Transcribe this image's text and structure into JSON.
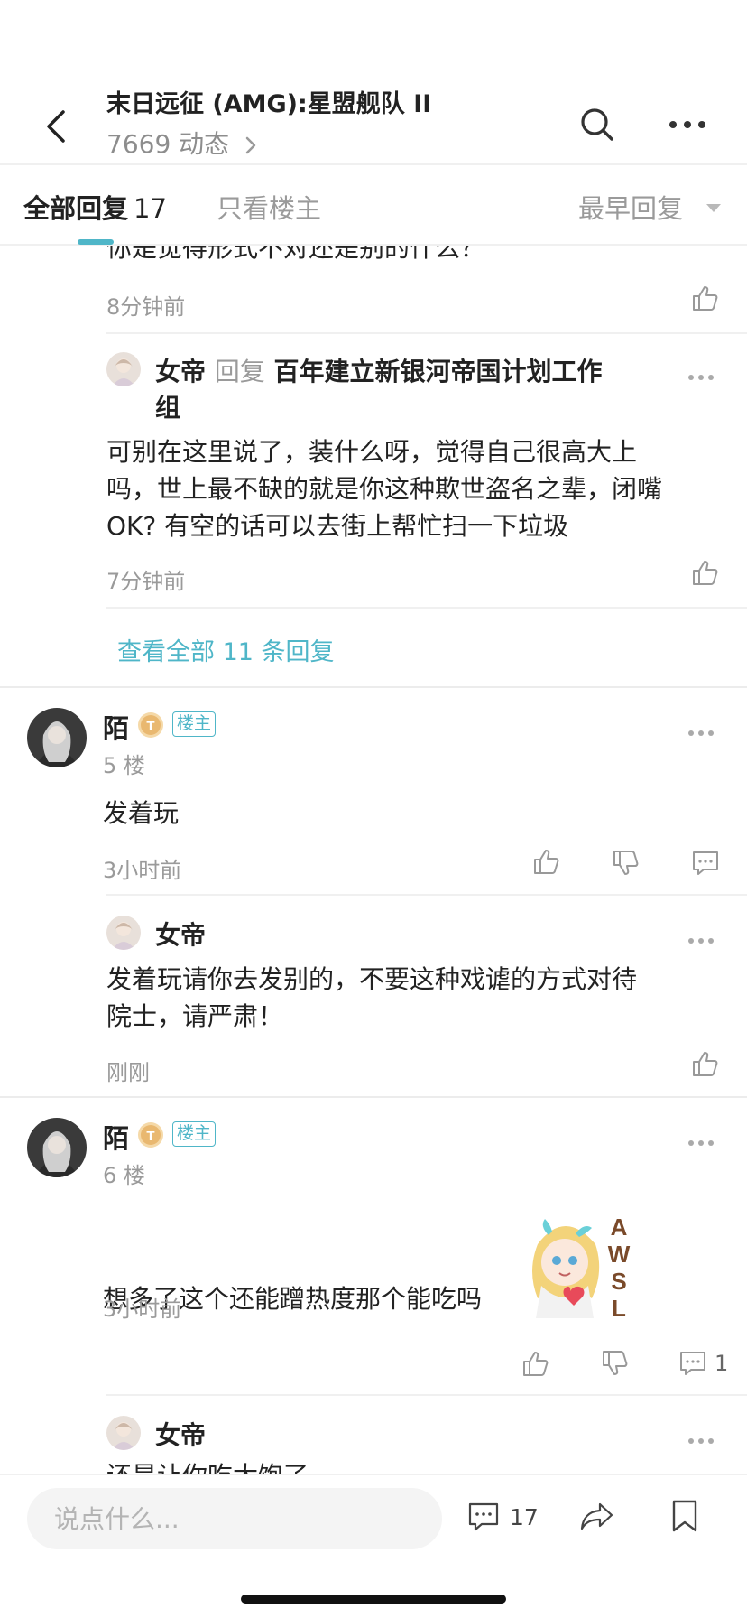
{
  "nav": {
    "title": "末日远征 (AMG):星盟舰队 II",
    "subtitle": "7669 动态"
  },
  "tabs": {
    "all_label": "全部回复",
    "all_count": "17",
    "owner_only": "只看楼主",
    "sort": "最早回复"
  },
  "thread": {
    "partial_text": "你是觉得形式不对还是别的什么？",
    "partial_time": "8分钟前",
    "reply1": {
      "author": "女帝",
      "reply_word": "回复",
      "target_line1": "百年建立新银河帝国计划工作",
      "target_line2": "组",
      "text_line1": "可别在这里说了，装什么呀，觉得自己很高大上",
      "text_line2": "吗，世上最不缺的就是你这种欺世盗名之辈，闭嘴",
      "text_line3": "OK?  有空的话可以去街上帮忙扫一下垃圾",
      "time": "7分钟前"
    },
    "view_all": "查看全部 11 条回复"
  },
  "posts": [
    {
      "author": "陌",
      "owner_badge": "楼主",
      "floor": "5 楼",
      "text": "发着玩",
      "time": "3小时前",
      "reply": {
        "author": "女帝",
        "text_line1": "发着玩请你去发别的，不要这种戏谑的方式对待",
        "text_line2": "院士，请严肃！",
        "time": "刚刚"
      }
    },
    {
      "author": "陌",
      "owner_badge": "楼主",
      "floor": "6 楼",
      "text": "想多了这个还能蹭热度那个能吃吗",
      "sticker_text": "AWSL",
      "time": "3小时前",
      "comment_count": "1",
      "reply": {
        "author": "女帝",
        "text_line1": "还是让你吃太饱了"
      }
    }
  ],
  "bottom": {
    "input_placeholder": "说点什么...",
    "comment_count": "17"
  },
  "colors": {
    "accent": "#4fb6c8",
    "muted": "#9a9a9a",
    "text": "#222222"
  }
}
